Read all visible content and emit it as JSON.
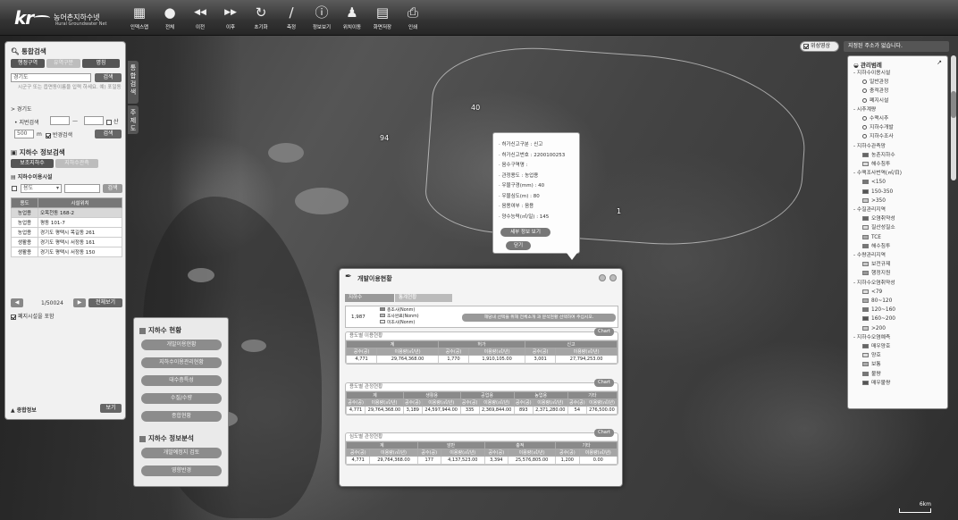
{
  "toolbar": {
    "logo_text": "kr",
    "service_name": "농어촌지하수넷",
    "service_sub": "Rural Groundwater Net",
    "tools": [
      {
        "label": "인덱스맵",
        "icon": "index-map-icon"
      },
      {
        "label": "전체",
        "icon": "globe-icon"
      },
      {
        "label": "이전",
        "icon": "previous-icon"
      },
      {
        "label": "이후",
        "icon": "next-icon"
      },
      {
        "label": "초기화",
        "icon": "reset-icon"
      },
      {
        "label": "측정",
        "icon": "ruler-icon"
      },
      {
        "label": "정보보기",
        "icon": "info-icon"
      },
      {
        "label": "위치이동",
        "icon": "person-icon"
      },
      {
        "label": "화면저장",
        "icon": "save-screen-icon"
      },
      {
        "label": "인쇄",
        "icon": "printer-icon"
      }
    ]
  },
  "left_panel": {
    "title": "통합검색",
    "tabs": [
      "행정구역",
      "유역구분",
      "명칭"
    ],
    "region_input": "경기도",
    "search_button": "검색",
    "hint": "시군구 또는 읍면동이름을 입력 하세요. 예) 포일동",
    "region_line": "> 경기도",
    "jibun_label": "• 지번검색",
    "jibun_dash": "—",
    "mountain_label": "산",
    "radius_value": "500",
    "radius_unit": "m",
    "radius_check": "반경검색",
    "info_title": "지하수 정보검색",
    "info_tabs": [
      "보조지하수",
      "지하수관측"
    ],
    "facility_title": "지하수이용시설",
    "filter_select": "용도",
    "filter_button": "검색",
    "table_headers": [
      "용도",
      "시설위치"
    ],
    "table_rows": [
      [
        "농업용",
        "오목천동 168-2"
      ],
      [
        "농업용",
        "평동 101-7"
      ],
      [
        "농업용",
        "경기도 평택시 목길동 261"
      ],
      [
        "생활용",
        "경기도 평택시 서정동 161"
      ],
      [
        "생활용",
        "경기도 평택시 서정동 150"
      ]
    ],
    "pager": "1/50024",
    "all_button": "전체보기",
    "include_closed": "폐지시설을 포함",
    "footer_label": "종합정보",
    "footer_button": "보기"
  },
  "vertical_tabs": [
    "통합검색",
    "주제도"
  ],
  "groundwater_box": {
    "status_title": "지하수 현황",
    "status_buttons": [
      "개발이용현황",
      "지하수이용관리현황",
      "대수층특성",
      "수질/수량",
      "종합현황"
    ],
    "analysis_title": "지하수 정보분석",
    "analysis_buttons": [
      "개발예정지 검토",
      "영향반경"
    ]
  },
  "popup": {
    "lines": [
      "· 허가신고구분 : 신고",
      "· 허가신고번호 : 2200100253",
      "· 음수구역명 :",
      "· 관정용도 : 농업용",
      "· 우물구경(mm) : 40",
      "· 우물심도(m) : 80",
      "· 음용여부 : 음용",
      "· 양수능력(㎥/일) : 145"
    ],
    "detail_button": "세부 정보 보기",
    "close_button": "닫기"
  },
  "status_dialog": {
    "title": "개발이용현황",
    "tab_labels": [
      "지하수",
      "통계현황"
    ],
    "counts_total": "1,987",
    "legend_rows": [
      "총조사(Nonm)",
      "조사완료(Nonm)",
      "미조사(Nonm)"
    ],
    "notice": "해당내 선택을 위해 전체소개 과 분석현황 선택하여 주십시오.",
    "groups": [
      {
        "title": "용도별 이용현황",
        "button": "Chart",
        "header_top": [
          "계",
          "허가",
          "신고"
        ],
        "header_sub": [
          "공수(공)",
          "이용량(㎥/년)",
          "공수(공)",
          "이용량(㎥/년)",
          "공수(공)",
          "이용량(㎥/년)"
        ],
        "values": [
          "4,771",
          "29,764,368.00",
          "1,770",
          "1,910,105.00",
          "3,001",
          "27,794,253.00"
        ]
      },
      {
        "title": "용도별 관정현황",
        "button": "Chart",
        "header_top": [
          "계",
          "생활용",
          "공업용",
          "농업용",
          "기타"
        ],
        "header_sub": [
          "공수(공)",
          "이용량(㎥/년)",
          "공수(공)",
          "이용량(㎥/년)",
          "공수(공)",
          "이용량(㎥/년)",
          "공수(공)",
          "이용량(㎥/년)",
          "공수(공)",
          "이용량(㎥/년)"
        ],
        "values": [
          "4,771",
          "29,764,368.00",
          "3,189",
          "24,597,944.00",
          "335",
          "2,369,844.00",
          "893",
          "2,371,280.00",
          "54",
          "276,500.00"
        ]
      },
      {
        "title": "심도별 관정현황",
        "button": "Chart",
        "header_top": [
          "계",
          "암반",
          "충적",
          "기타"
        ],
        "header_sub": [
          "공수(공)",
          "이용량(㎥/년)",
          "공수(공)",
          "이용량(㎥/년)",
          "공수(공)",
          "이용량(㎥/년)",
          "공수(공)",
          "이용량(㎥/년)"
        ],
        "values": [
          "4,771",
          "29,764,368.00",
          "177",
          "4,137,523.00",
          "3,394",
          "25,576,805.00",
          "1,200",
          "0.00"
        ]
      }
    ]
  },
  "sat_check": "위성영상",
  "address_bar": "지정된 주소가 없습니다.",
  "legend": {
    "title": "관리범례",
    "items": [
      {
        "t": "- 지하수이용시설",
        "k": "head"
      },
      {
        "t": "일반관정",
        "k": "dot"
      },
      {
        "t": "충적관정",
        "k": "dot"
      },
      {
        "t": "폐지시설",
        "k": "dot"
      },
      {
        "t": "- 시추계량",
        "k": "head"
      },
      {
        "t": "수맥시추",
        "k": "dot"
      },
      {
        "t": "지하수개발",
        "k": "dot"
      },
      {
        "t": "지하수조사",
        "k": "dot"
      },
      {
        "t": "- 지하수관측망",
        "k": "head"
      },
      {
        "t": "농촌지하수",
        "k": "sw"
      },
      {
        "t": "해수침투",
        "k": "sw"
      },
      {
        "t": "- 수맥조사번역(㎥/日)",
        "k": "head"
      },
      {
        "t": "<150",
        "k": "sw"
      },
      {
        "t": "150-350",
        "k": "sw"
      },
      {
        "t": ">350",
        "k": "sw"
      },
      {
        "t": "- 수질관리지역",
        "k": "head"
      },
      {
        "t": "오염취약성",
        "k": "sw"
      },
      {
        "t": "질산성질소",
        "k": "sw"
      },
      {
        "t": "TCE",
        "k": "sw"
      },
      {
        "t": "해수침투",
        "k": "sw"
      },
      {
        "t": "- 수량관리지역",
        "k": "head"
      },
      {
        "t": "보전규제",
        "k": "sw"
      },
      {
        "t": "행정지원",
        "k": "sw"
      },
      {
        "t": "- 지하수오염취약성",
        "k": "head"
      },
      {
        "t": "<79",
        "k": "sw"
      },
      {
        "t": "80~120",
        "k": "sw"
      },
      {
        "t": "120~160",
        "k": "sw"
      },
      {
        "t": "160~200",
        "k": "sw"
      },
      {
        "t": ">200",
        "k": "sw"
      },
      {
        "t": "- 지하수오염예측",
        "k": "head"
      },
      {
        "t": "매우양호",
        "k": "sw"
      },
      {
        "t": "양호",
        "k": "sw"
      },
      {
        "t": "보통",
        "k": "sw"
      },
      {
        "t": "불량",
        "k": "sw"
      },
      {
        "t": "매우불량",
        "k": "sw"
      }
    ]
  },
  "map_labels": [
    "94",
    "40",
    "1"
  ],
  "scale_label": "6km"
}
